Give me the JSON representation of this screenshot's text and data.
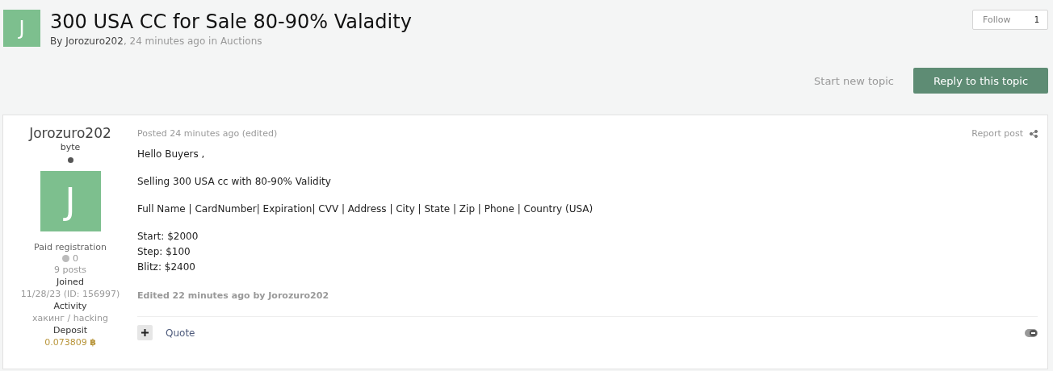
{
  "topic": {
    "avatar_letter": "J",
    "title": "300 USA CC for Sale 80-90% Valadity",
    "byline": {
      "prefix": "By",
      "author": "Jorozuro202",
      "meta": ", 24 minutes ago in",
      "forum": "Auctions"
    }
  },
  "follow": {
    "label": "Follow",
    "count": "1"
  },
  "actions": [
    {
      "kind": "link",
      "label": "Start new topic"
    },
    {
      "kind": "primary",
      "label": "Reply to this topic"
    }
  ],
  "author": {
    "name": "Jorozuro202",
    "rank": "byte",
    "online": false,
    "avatar_letter": "J",
    "group": "Paid registration",
    "reputation": "0",
    "posts": "9 posts",
    "fields": [
      {
        "label": "Joined",
        "value": "11/28/23 (ID: 156997)",
        "kind": "plain"
      },
      {
        "label": "Activity",
        "value": "хакинг / hacking",
        "kind": "plain"
      },
      {
        "label": "Deposit",
        "value": "0.073809",
        "symbol": "฿",
        "kind": "currency"
      }
    ]
  },
  "post": {
    "meta": "Posted 24 minutes ago (edited)",
    "report": "Report post",
    "paragraphs": [
      [
        "Hello Buyers ,"
      ],
      [
        "Selling 300 USA cc with 80-90% Validity"
      ],
      [
        "Full Name | CardNumber| Expiration| CVV | Address | City | State | Zip | Phone | Country (USA)"
      ],
      [
        "Start: $2000",
        "Step: $100",
        "Blitz: $2400"
      ]
    ],
    "edited": "Edited 22 minutes ago by Jorozuro202",
    "quote": "Quote"
  }
}
